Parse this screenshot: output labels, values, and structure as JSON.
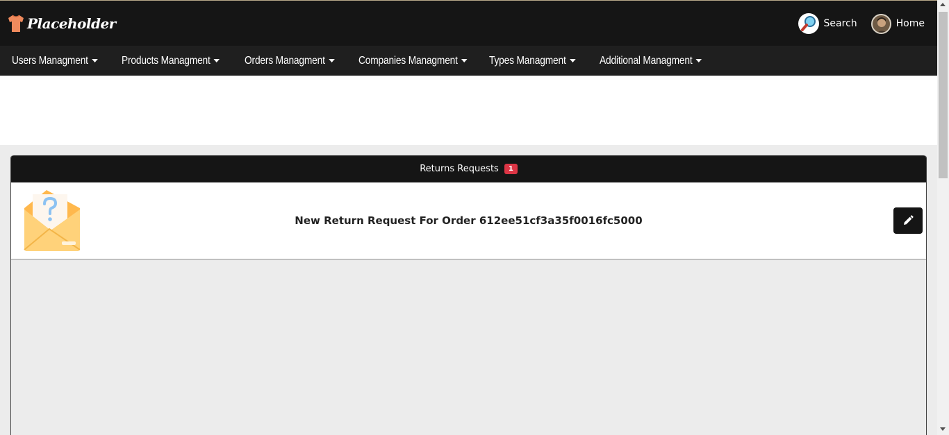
{
  "header": {
    "logo_text": "Placeholder",
    "logo_icon": "tshirt-icon",
    "search_label": "Search",
    "home_label": "Home"
  },
  "nav": {
    "items": [
      {
        "label": "Users Managment"
      },
      {
        "label": "Products Managment"
      },
      {
        "label": "Orders Managment"
      },
      {
        "label": "Companies Managment"
      },
      {
        "label": "Types Managment"
      },
      {
        "label": "Additional Managment"
      }
    ]
  },
  "panel": {
    "title": "Returns Requests",
    "count": "1",
    "requests": [
      {
        "text": "New Return Request For Order 612ee51cf3a35f0016fc5000",
        "icon": "envelope-question-icon",
        "action_icon": "pencil-icon"
      }
    ]
  },
  "colors": {
    "topbar": "#151515",
    "navbar": "#1f1f1f",
    "badge": "#dc3545",
    "envelope": "#ffc86b"
  }
}
